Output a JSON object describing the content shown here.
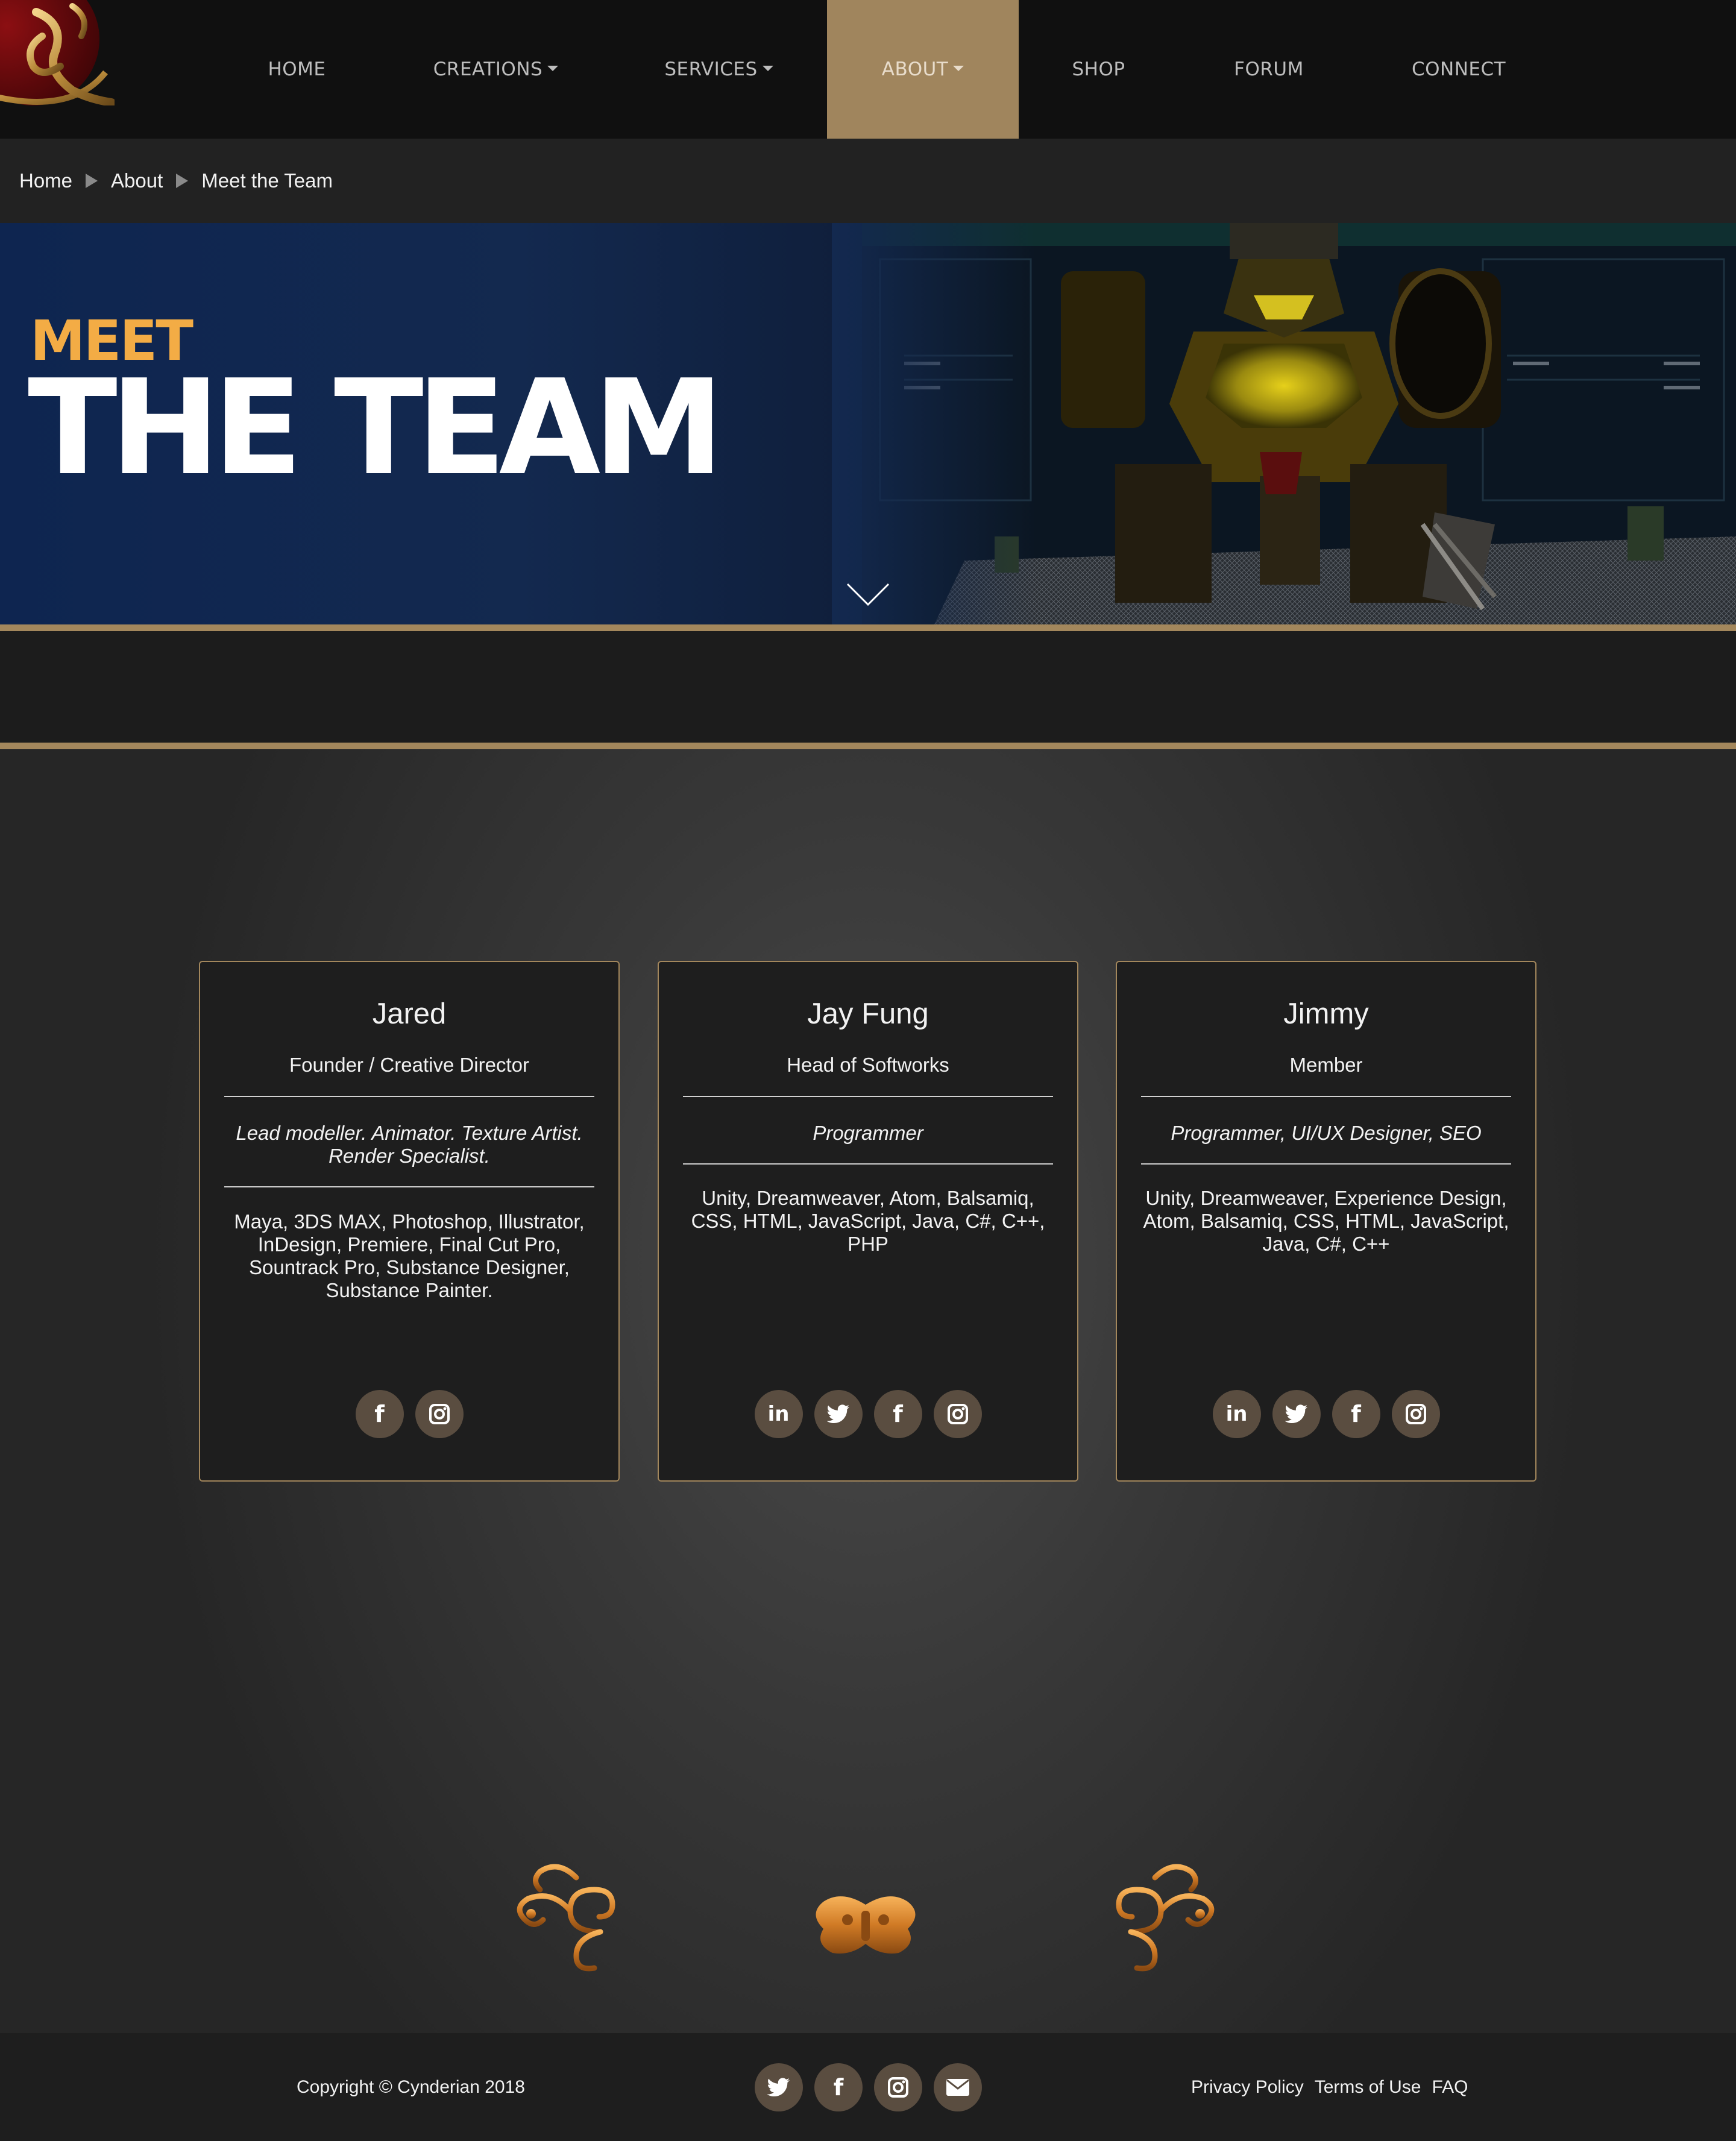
{
  "nav": {
    "items": [
      {
        "label": "HOME",
        "dropdown": false
      },
      {
        "label": "CREATIONS",
        "dropdown": true
      },
      {
        "label": "SERVICES",
        "dropdown": true
      },
      {
        "label": "ABOUT",
        "dropdown": true,
        "active": true
      },
      {
        "label": "SHOP",
        "dropdown": false
      },
      {
        "label": "FORUM",
        "dropdown": false
      },
      {
        "label": "CONNECT",
        "dropdown": false
      }
    ]
  },
  "breadcrumb": [
    "Home",
    "About",
    "Meet the Team"
  ],
  "hero": {
    "eyebrow": "MEET",
    "title": "THE TEAM"
  },
  "team": [
    {
      "name": "Jared",
      "role": "Founder / Creative Director",
      "specialty": "Lead modeller. Animator. Texture Artist. Render Specialist.",
      "skills": "Maya, 3DS MAX, Photoshop, Illustrator, InDesign, Premiere, Final Cut Pro, Sountrack Pro, Substance Designer, Substance Painter.",
      "social": [
        "facebook-icon",
        "instagram-icon"
      ]
    },
    {
      "name": "Jay Fung",
      "role": "Head of Softworks",
      "specialty": "Programmer",
      "skills": "Unity, Dreamweaver, Atom, Balsamiq, CSS, HTML, JavaScript, Java, C#, C++, PHP",
      "social": [
        "linkedin-icon",
        "twitter-icon",
        "facebook-icon",
        "instagram-icon"
      ]
    },
    {
      "name": "Jimmy",
      "role": "Member",
      "specialty": "Programmer, UI/UX Designer, SEO",
      "skills": "Unity, Dreamweaver, Experience Design, Atom, Balsamiq, CSS, HTML, JavaScript, Java, C#, C++",
      "social": [
        "linkedin-icon",
        "twitter-icon",
        "facebook-icon",
        "instagram-icon"
      ]
    }
  ],
  "footer": {
    "copyright": "Copyright © Cynderian 2018",
    "social": [
      "twitter-icon",
      "facebook-icon",
      "instagram-icon",
      "email-icon"
    ],
    "links": [
      "Privacy Policy",
      "Terms of Use",
      "FAQ"
    ]
  },
  "colors": {
    "accent_gold": "#a3875c",
    "hero_eyebrow": "#f3ac45",
    "social_button": "#5a4d40"
  }
}
